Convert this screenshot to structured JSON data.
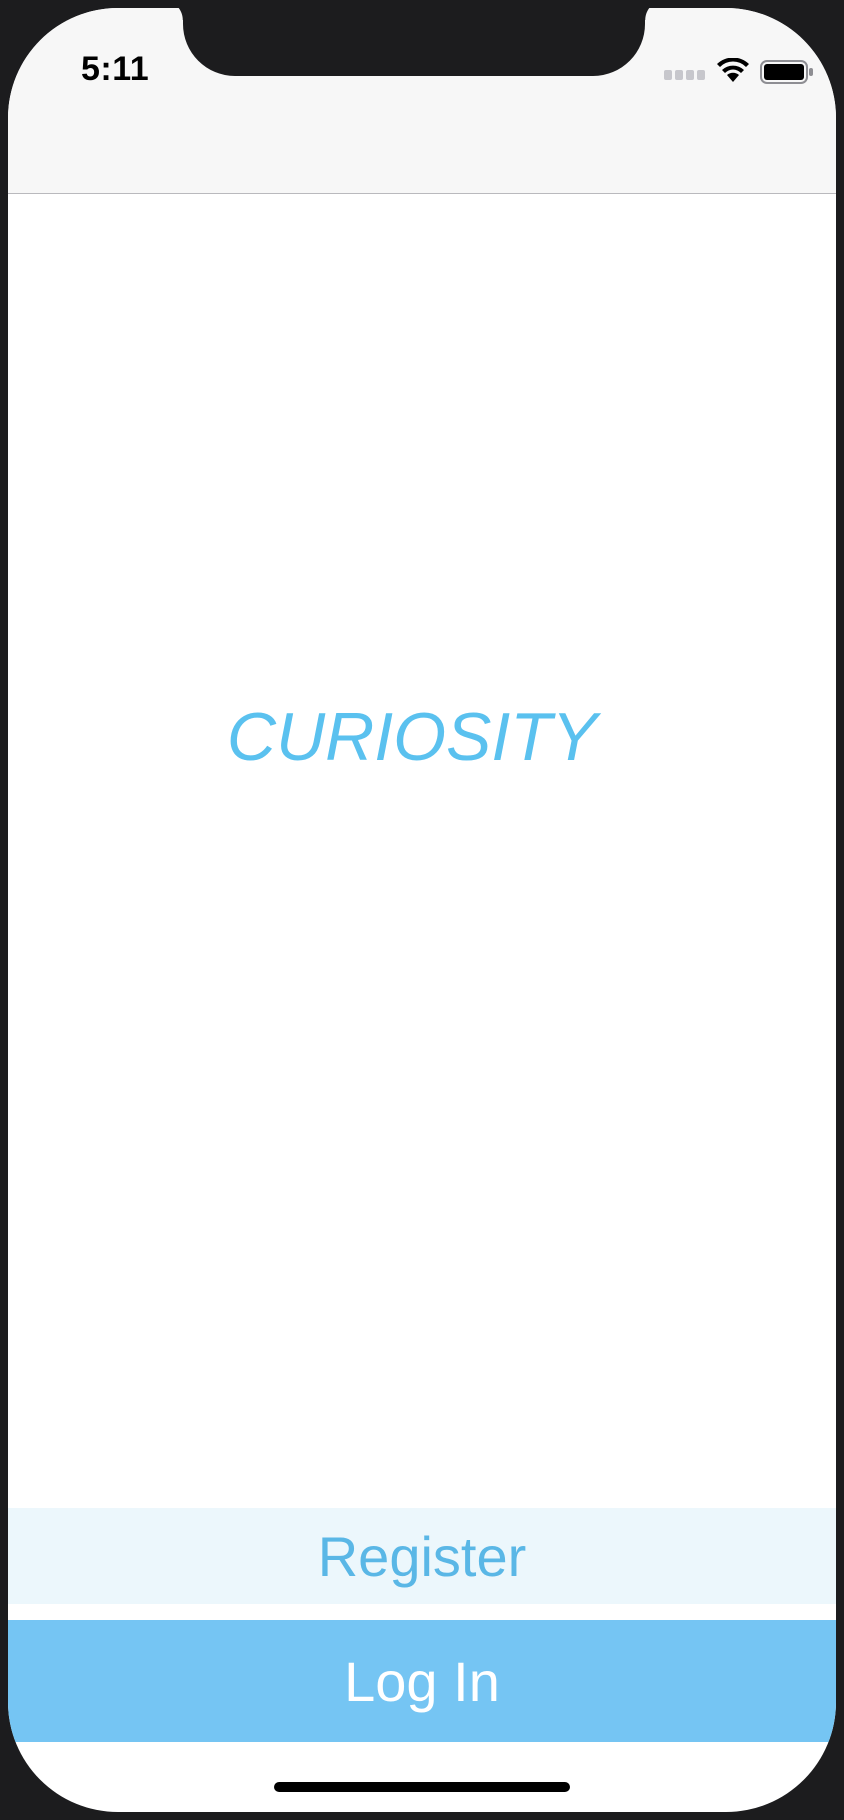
{
  "status_bar": {
    "time": "5:11",
    "signal_icon": "cellular-signal-icon",
    "wifi_icon": "wifi-icon",
    "battery_icon": "battery-icon"
  },
  "main": {
    "title": "CURIOSITY"
  },
  "actions": {
    "register_label": "Register",
    "login_label": "Log In"
  },
  "colors": {
    "accent": "#5ac1ef",
    "login_bg": "#75c5f3",
    "register_bg": "#ecf7fc",
    "register_text": "#5ab7e6",
    "nav_bg": "#f7f7f7"
  }
}
